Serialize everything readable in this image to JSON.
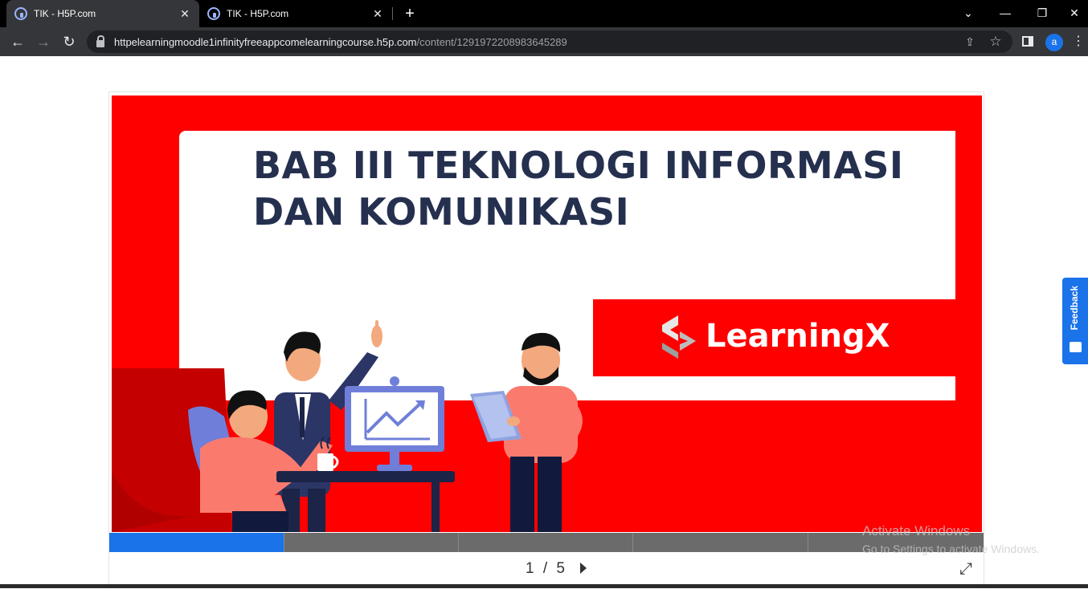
{
  "browser": {
    "tabs": [
      {
        "title": "TIK - H5P.com",
        "active": true
      },
      {
        "title": "TIK - H5P.com",
        "active": false
      }
    ],
    "close_glyph": "✕",
    "new_tab_glyph": "+",
    "window_controls": {
      "chevron": "⌄",
      "minimize": "—",
      "restore": "❐",
      "close": "✕"
    },
    "nav": {
      "back": "←",
      "forward": "→",
      "reload": "↻"
    },
    "url_host": "httpelearningmoodle1infinityfreeappcomelearningcourse.h5p.com",
    "url_path": "/content/1291972208983645289",
    "share_glyph": "⇪",
    "bookmark_glyph": "☆",
    "profile_initial": "a",
    "menu_glyph": "⋮"
  },
  "slide": {
    "title_line1": "BAB III TEKNOLOGI INFORMASI",
    "title_line2": "DAN KOMUNIKASI",
    "brand": "LearningX",
    "colors": {
      "background": "#ff0000",
      "title": "#25304f",
      "card": "#ffffff"
    }
  },
  "presentation": {
    "current_slide": 1,
    "total_slides": 5,
    "counter_text": "1 / 5",
    "fullscreen_glyph": "⤢"
  },
  "feedback": {
    "label": "Feedback"
  },
  "watermark": {
    "title": "Activate Windows",
    "subtitle": "Go to Settings to activate Windows."
  }
}
